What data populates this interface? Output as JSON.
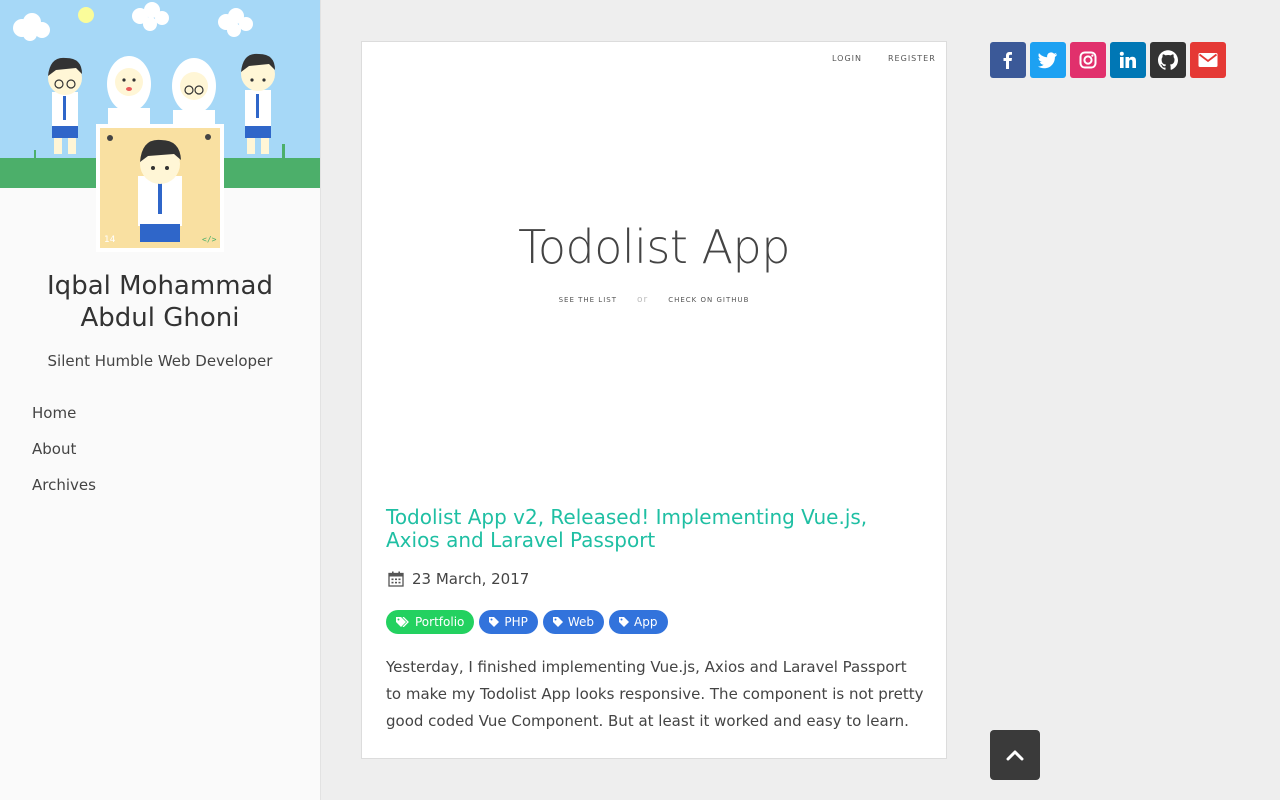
{
  "profile": {
    "name_line1": "Iqbal Mohammad",
    "name_line2": "Abdul Ghoni",
    "tagline": "Silent Humble Web Developer",
    "avatar_corner_number": "14"
  },
  "nav": {
    "items": [
      {
        "label": "Home"
      },
      {
        "label": "About"
      },
      {
        "label": "Archives"
      }
    ]
  },
  "preview": {
    "login": "LOGIN",
    "register": "REGISTER",
    "title": "Todolist App",
    "see_list": "SEE THE LIST",
    "or": "or",
    "github": "CHECK ON GITHUB"
  },
  "post": {
    "title": "Todolist App v2, Released! Implementing Vue.js, Axios and Laravel Passport",
    "date": "23 March, 2017",
    "tags": [
      {
        "label": "Portfolio",
        "color": "#23d160",
        "icon": "tags-icon"
      },
      {
        "label": "PHP",
        "color": "#3273dc",
        "icon": "tag-icon"
      },
      {
        "label": "Web",
        "color": "#3273dc",
        "icon": "tag-icon"
      },
      {
        "label": "App",
        "color": "#3273dc",
        "icon": "tag-icon"
      }
    ],
    "excerpt": "Yesterday, I finished implementing Vue.js, Axios and Laravel Passport to make my Todolist App looks responsive. The component is not pretty good coded Vue Component. But at least it worked and easy to learn."
  },
  "social": [
    {
      "name": "facebook-icon",
      "color": "#3b5998"
    },
    {
      "name": "twitter-icon",
      "color": "#1da1f2"
    },
    {
      "name": "instagram-icon",
      "color": "#e1306c"
    },
    {
      "name": "linkedin-icon",
      "color": "#0077b5"
    },
    {
      "name": "github-icon",
      "color": "#333333"
    },
    {
      "name": "email-icon",
      "color": "#e53935"
    }
  ],
  "colors": {
    "accent": "#1fbfa3",
    "sky": "#a6d8f7",
    "grass": "#4caf6a",
    "avatar_bg": "#f9e0a1"
  }
}
